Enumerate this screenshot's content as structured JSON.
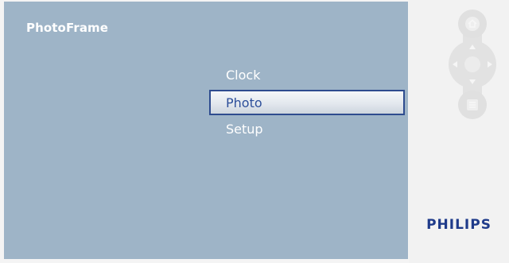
{
  "screen": {
    "title": "PhotoFrame",
    "menu": [
      {
        "label": "Clock",
        "selected": false
      },
      {
        "label": "Photo",
        "selected": true
      },
      {
        "label": "Setup",
        "selected": false
      }
    ]
  },
  "side_panel": {
    "brand": "PHILIPS",
    "controls": [
      "home-button-icon",
      "dpad-icon",
      "menu-button-icon"
    ]
  },
  "colors": {
    "screen_background": "#9eb4c7",
    "selection_border": "#2e4c8f",
    "selected_text": "#2d4f9a",
    "brand": "#1f3b8a"
  }
}
